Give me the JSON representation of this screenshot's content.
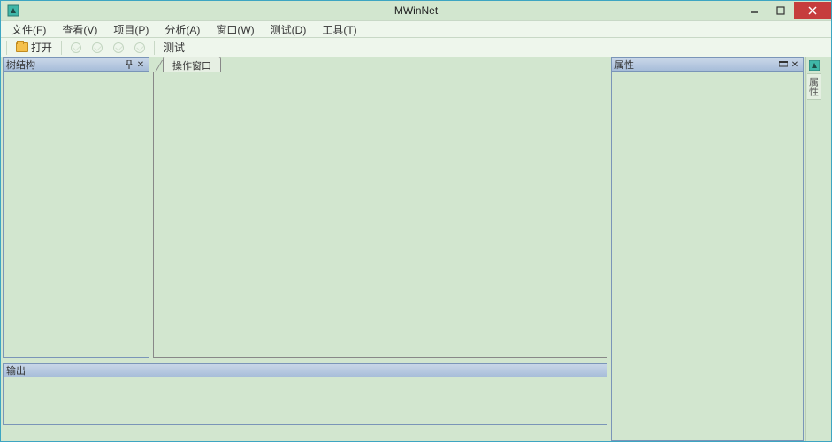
{
  "app": {
    "title": "MWinNet"
  },
  "menu": {
    "file": "文件(F)",
    "view": "查看(V)",
    "project": "项目(P)",
    "analyze": "分析(A)",
    "window": "窗口(W)",
    "test": "测试(D)",
    "tools": "工具(T)"
  },
  "toolbar": {
    "open": "打开",
    "test": "测试"
  },
  "panels": {
    "tree": "树结构",
    "doc_tab": "操作窗口",
    "output": "输出",
    "properties": "属性",
    "gutter_tab": "属性"
  }
}
